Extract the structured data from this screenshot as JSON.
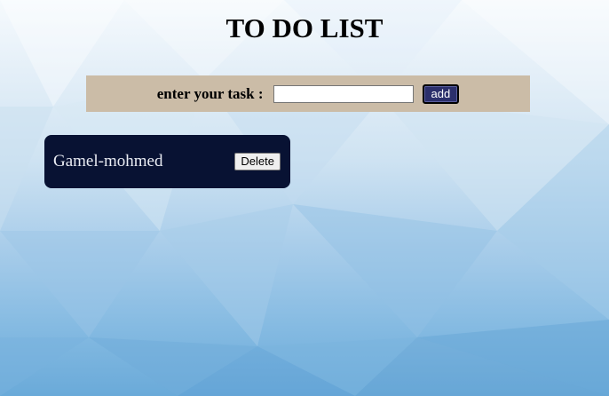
{
  "header": {
    "title": "TO DO LIST"
  },
  "form": {
    "label": "enter your task :",
    "input_value": "",
    "add_label": "add"
  },
  "tasks": [
    {
      "text": "Gamel-mohmed",
      "delete_label": "Delete"
    }
  ],
  "colors": {
    "bar": "#cbbca7",
    "task_bg": "#081233",
    "add_button": "#2b2f6b"
  }
}
